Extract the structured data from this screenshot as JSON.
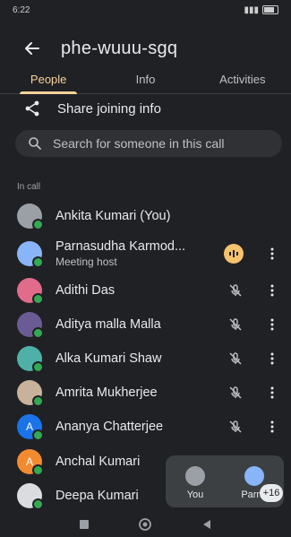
{
  "status_bar": {
    "time": "6:22"
  },
  "app_bar": {
    "title": "phe-wuuu-sgq"
  },
  "tabs": [
    {
      "label": "People"
    },
    {
      "label": "Info"
    },
    {
      "label": "Activities"
    }
  ],
  "share": {
    "label": "Share joining info"
  },
  "search": {
    "placeholder": "Search for someone in this call"
  },
  "section": {
    "label": "In call"
  },
  "participants": [
    {
      "name": "Ankita Kumari (You)",
      "subtitle": "",
      "avatar_color": "#9aa0a6",
      "state": "none"
    },
    {
      "name": "Parnasudha Karmod...",
      "subtitle": "Meeting host",
      "avatar_color": "#8ab4f8",
      "state": "speaking"
    },
    {
      "name": "Adithi Das",
      "subtitle": "",
      "avatar_color": "#e06b8b",
      "state": "muted"
    },
    {
      "name": "Aditya malla Malla",
      "subtitle": "",
      "avatar_color": "#6b5b95",
      "state": "muted"
    },
    {
      "name": "Alka Kumari Shaw",
      "subtitle": "",
      "avatar_color": "#4fb0a8",
      "state": "muted"
    },
    {
      "name": "Amrita Mukherjee",
      "subtitle": "",
      "avatar_color": "#c9b29b",
      "state": "muted"
    },
    {
      "name": "Ananya Chatterjee",
      "subtitle": "",
      "avatar_color": "#1a73e8",
      "avatar_letter": "A",
      "state": "muted"
    },
    {
      "name": "Anchal Kumari",
      "subtitle": "",
      "avatar_color": "#f28b30",
      "avatar_letter": "A",
      "state": "none"
    },
    {
      "name": "Deepa Kumari",
      "subtitle": "",
      "avatar_color": "#dadce0",
      "state": "none"
    }
  ],
  "self_view": {
    "tiles": [
      {
        "label": "You"
      },
      {
        "label": "Parna"
      }
    ],
    "more_count": "+16"
  },
  "colors": {
    "background": "#202124",
    "accent": "#f6d39a",
    "presence": "#34a853",
    "speaking": "#f6c26b"
  }
}
